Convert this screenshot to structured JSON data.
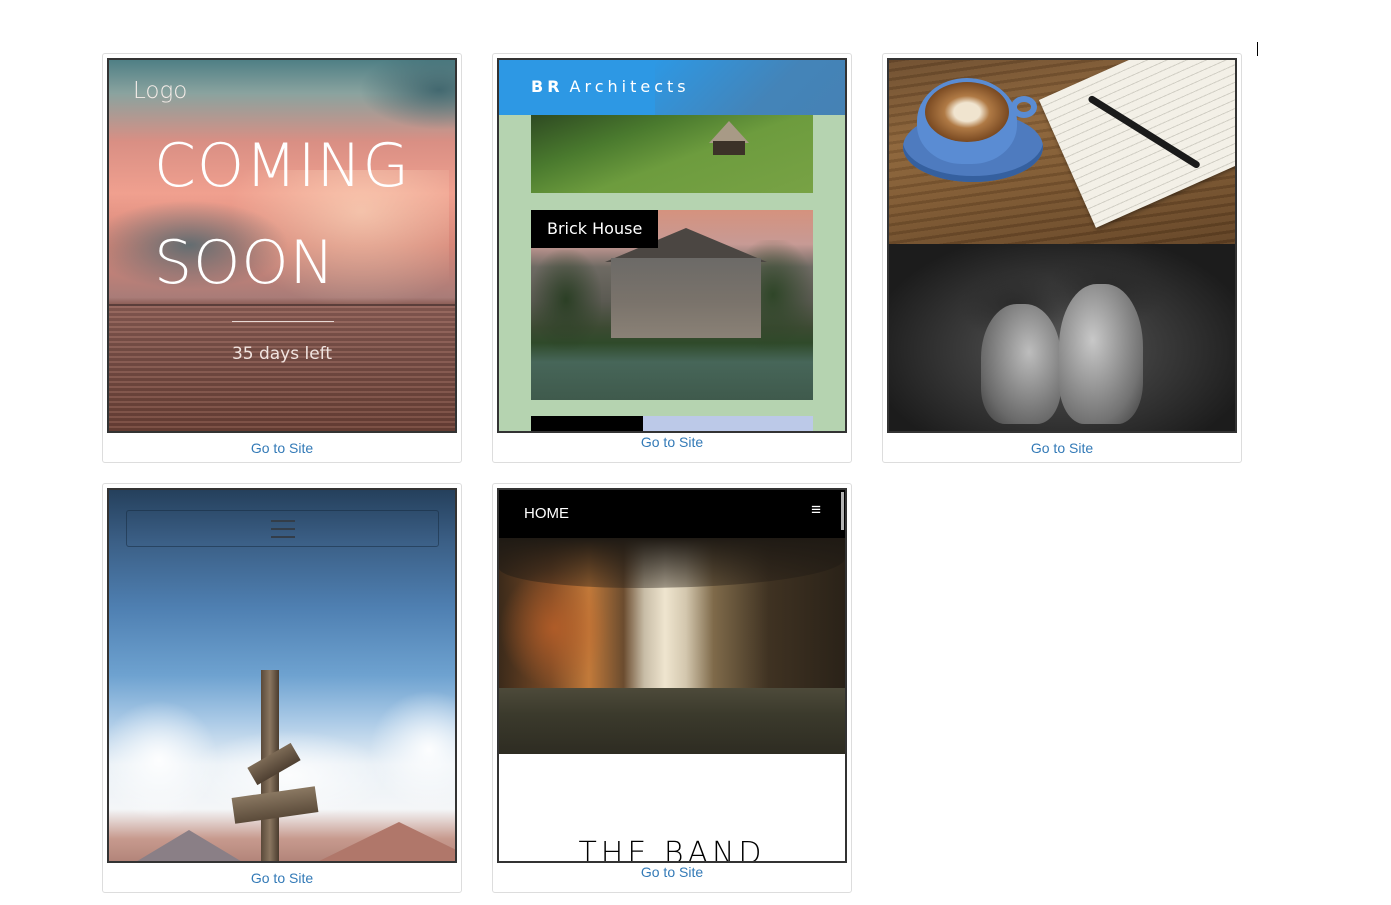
{
  "cards": [
    {
      "id": "coming-soon",
      "logo": "Logo",
      "title_line1": "COMING",
      "title_line2": "SOON",
      "countdown": "35 days left",
      "link": "Go to Site"
    },
    {
      "id": "br-architects",
      "brand_bold": "BR",
      "brand_rest": "Architects",
      "project_label": "Brick House",
      "link": "Go to Site"
    },
    {
      "id": "coffee-portrait",
      "link": "Go to Site"
    },
    {
      "id": "sky-cross",
      "menu_icon": "hamburger-icon",
      "link": "Go to Site"
    },
    {
      "id": "the-band",
      "nav_home": "HOME",
      "menu_glyph": "≡",
      "title": "THE BAND",
      "link": "Go to Site"
    }
  ],
  "colors": {
    "link": "#337ab7",
    "arch_nav": "#2d98e4",
    "arch_bg": "#b5d3b0",
    "band_nav": "#000000"
  }
}
